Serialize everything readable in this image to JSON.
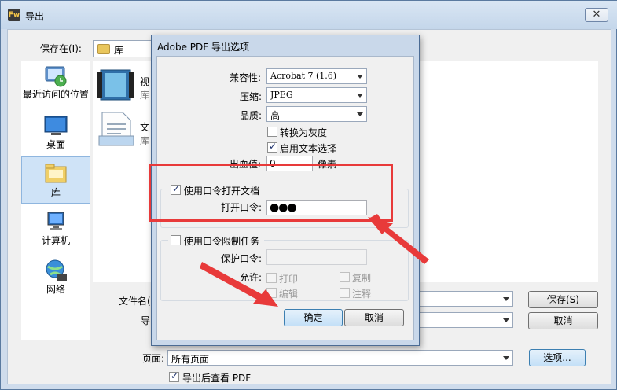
{
  "window": {
    "title": "导出",
    "logo": "Fw",
    "close_glyph": "✕"
  },
  "save_in": {
    "label": "保存在(I):",
    "value": "库"
  },
  "places": [
    {
      "label": "最近访问的位置",
      "icon": "recent-places-icon"
    },
    {
      "label": "桌面",
      "icon": "desktop-icon"
    },
    {
      "label": "库",
      "icon": "library-icon",
      "selected": true
    },
    {
      "label": "计算机",
      "icon": "computer-icon"
    },
    {
      "label": "网络",
      "icon": "network-icon"
    }
  ],
  "files": [
    {
      "name": "视",
      "sub": "库",
      "icon": "video-library-icon"
    },
    {
      "name": "文",
      "sub": "库",
      "icon": "document-library-icon"
    }
  ],
  "filename": {
    "label": "文件名(",
    "value": ""
  },
  "type_label": "导",
  "page": {
    "label": "页面:",
    "value": "所有页面"
  },
  "view_after": {
    "label": "导出后查看 PDF",
    "checked": true
  },
  "buttons": {
    "save": "保存(S)",
    "cancel": "取消",
    "options": "选项..."
  },
  "pdf_dialog": {
    "title": "Adobe PDF 导出选项",
    "compat_label": "兼容性:",
    "compat_value": "Acrobat 7 (1.6)",
    "compress_label": "压缩:",
    "compress_value": "JPEG",
    "quality_label": "品质:",
    "quality_value": "高",
    "grayscale_label": "转换为灰度",
    "grayscale_checked": false,
    "text_select_label": "启用文本选择",
    "text_select_checked": true,
    "bleed_label": "出血值:",
    "bleed_value": "0",
    "bleed_unit": "像素",
    "open_pw_group_label": "使用口令打开文档",
    "open_pw_checked": true,
    "open_pw_label": "打开口令:",
    "open_pw_masked": "●●●",
    "perm_group_label": "使用口令限制任务",
    "perm_checked": false,
    "protect_label": "保护口令:",
    "allow_label": "允许:",
    "allow_print": "打印",
    "allow_copy": "复制",
    "allow_edit": "编辑",
    "allow_comment": "注释",
    "ok": "确定",
    "cancel": "取消"
  },
  "annotation_color": "#e83a3a"
}
